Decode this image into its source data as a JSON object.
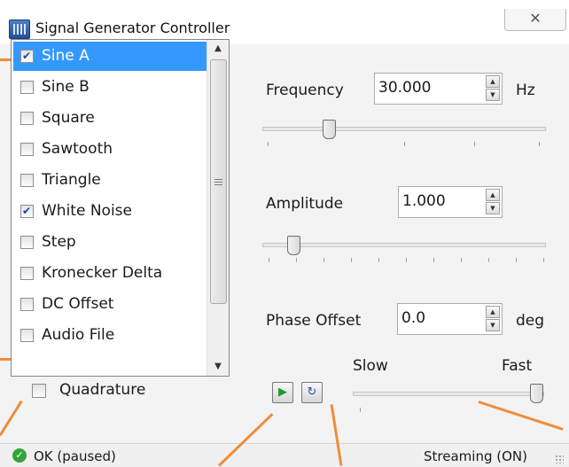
{
  "window": {
    "title": "Signal Generator Controller",
    "close_glyph": "✕",
    "app_icon": "signal-app-icon"
  },
  "signals": [
    {
      "label": "Sine A",
      "checked": true,
      "selected": true
    },
    {
      "label": "Sine B",
      "checked": false,
      "selected": false
    },
    {
      "label": "Square",
      "checked": false,
      "selected": false
    },
    {
      "label": "Sawtooth",
      "checked": false,
      "selected": false
    },
    {
      "label": "Triangle",
      "checked": false,
      "selected": false
    },
    {
      "label": "White Noise",
      "checked": true,
      "selected": false
    },
    {
      "label": "Step",
      "checked": false,
      "selected": false
    },
    {
      "label": "Kronecker Delta",
      "checked": false,
      "selected": false
    },
    {
      "label": "DC Offset",
      "checked": false,
      "selected": false
    },
    {
      "label": "Audio File",
      "checked": false,
      "selected": false
    }
  ],
  "quadrature": {
    "label": "Quadrature",
    "checked": false
  },
  "frequency": {
    "label": "Frequency",
    "value": "30.000",
    "unit": "Hz"
  },
  "amplitude": {
    "label": "Amplitude",
    "value": "1.000"
  },
  "phase": {
    "label": "Phase Offset",
    "value": "0.0",
    "unit": "deg"
  },
  "speed": {
    "slow_label": "Slow",
    "fast_label": "Fast"
  },
  "status": {
    "text": "OK (paused)",
    "streaming": "Streaming (ON)"
  },
  "colors": {
    "selection": "#3399ff",
    "annotation_arrow": "#f08c3a",
    "ok": "#35a53a"
  }
}
